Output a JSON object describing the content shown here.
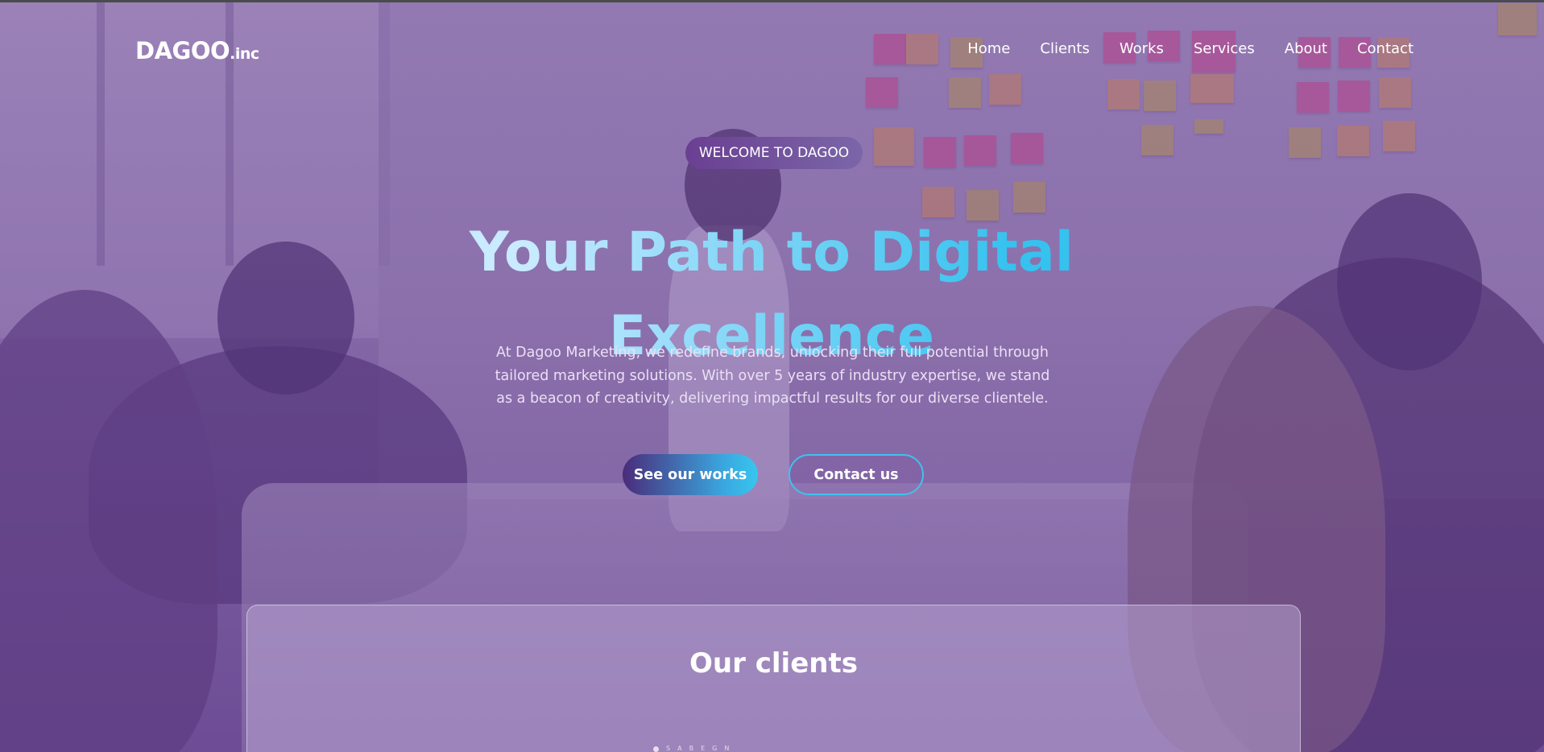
{
  "brand": {
    "name": "DAGOO",
    "suffix": ".inc"
  },
  "nav": {
    "items": [
      {
        "label": "Home"
      },
      {
        "label": "Clients"
      },
      {
        "label": "Works"
      },
      {
        "label": "Services"
      },
      {
        "label": "About"
      },
      {
        "label": "Contact"
      }
    ]
  },
  "hero": {
    "badge": "WELCOME TO DAGOO",
    "title_line1": "Your Path to Digital",
    "title_line2": "Excellence",
    "description": "At Dagoo Marketing, we redefine brands, unlocking their full potential through tailored marketing solutions. With over 5 years of industry expertise, we stand as a beacon of creativity, delivering impactful results for our diverse clientele.",
    "primary_button": "See our works",
    "secondary_button": "Contact us"
  },
  "clients": {
    "title": "Our clients",
    "carousel_glyphs": [
      "S",
      "A",
      "B",
      "E",
      "G",
      "N"
    ]
  },
  "colors": {
    "accent_cyan": "#37c6ee",
    "accent_purple": "#4a2c7a",
    "overlay_purple": "#7c56a5"
  }
}
